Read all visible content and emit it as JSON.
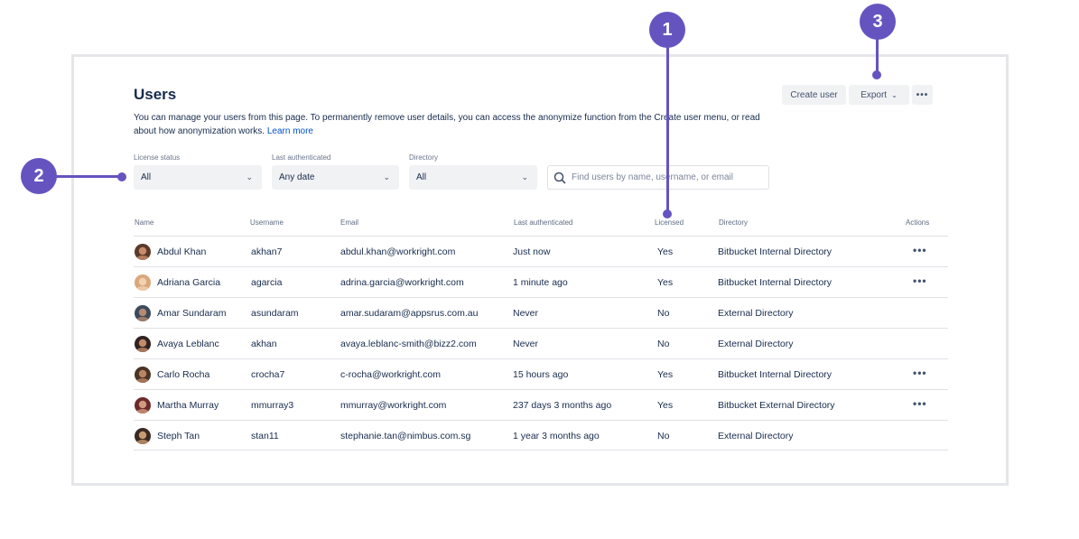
{
  "page": {
    "title": "Users",
    "description": "You can manage your users from this page. To permanently remove user details, you can access the anonymize function from the Create user menu, or read about how anonymization works.",
    "learn_more": "Learn more"
  },
  "header_actions": {
    "create_user": "Create user",
    "export": "Export",
    "more": "•••"
  },
  "filters": {
    "license_status": {
      "label": "License status",
      "value": "All"
    },
    "last_authenticated": {
      "label": "Last authenticated",
      "value": "Any date"
    },
    "directory": {
      "label": "Directory",
      "value": "All"
    },
    "search": {
      "placeholder": "Find users by name, username, or email"
    }
  },
  "table": {
    "columns": [
      "Name",
      "Username",
      "Email",
      "Last authenticated",
      "Licensed",
      "Directory",
      "Actions"
    ],
    "rows": [
      {
        "name": "Abdul Khan",
        "username": "akhan7",
        "email": "abdul.khan@workright.com",
        "last_auth": "Just now",
        "licensed": "Yes",
        "directory": "Bitbucket Internal Directory",
        "actions": "•••"
      },
      {
        "name": "Adriana Garcia",
        "username": "agarcia",
        "email": "adrina.garcia@workright.com",
        "last_auth": "1 minute ago",
        "licensed": "Yes",
        "directory": "Bitbucket Internal Directory",
        "actions": "•••"
      },
      {
        "name": "Amar Sundaram",
        "username": "asundaram",
        "email": "amar.sudaram@appsrus.com.au",
        "last_auth": "Never",
        "licensed": "No",
        "directory": "External Directory",
        "actions": ""
      },
      {
        "name": "Avaya Leblanc",
        "username": "akhan",
        "email": "avaya.leblanc-smith@bizz2.com",
        "last_auth": "Never",
        "licensed": "No",
        "directory": "External Directory",
        "actions": ""
      },
      {
        "name": "Carlo Rocha",
        "username": "crocha7",
        "email": "c-rocha@workright.com",
        "last_auth": "15 hours ago",
        "licensed": "Yes",
        "directory": "Bitbucket Internal Directory",
        "actions": "•••"
      },
      {
        "name": "Martha Murray",
        "username": "mmurray3",
        "email": "mmurray@workright.com",
        "last_auth": "237 days 3 months ago",
        "licensed": "Yes",
        "directory": "Bitbucket External Directory",
        "actions": "•••"
      },
      {
        "name": "Steph Tan",
        "username": "stan11",
        "email": "stephanie.tan@nimbus.com.sg",
        "last_auth": "1 year 3 months ago",
        "licensed": "No",
        "directory": "External Directory",
        "actions": ""
      }
    ]
  },
  "callouts": [
    "1",
    "2",
    "3"
  ],
  "colors": {
    "callout": "#6554c0",
    "link": "#0052cc",
    "button_bg": "#f1f2f4",
    "text": "#172b4d"
  }
}
